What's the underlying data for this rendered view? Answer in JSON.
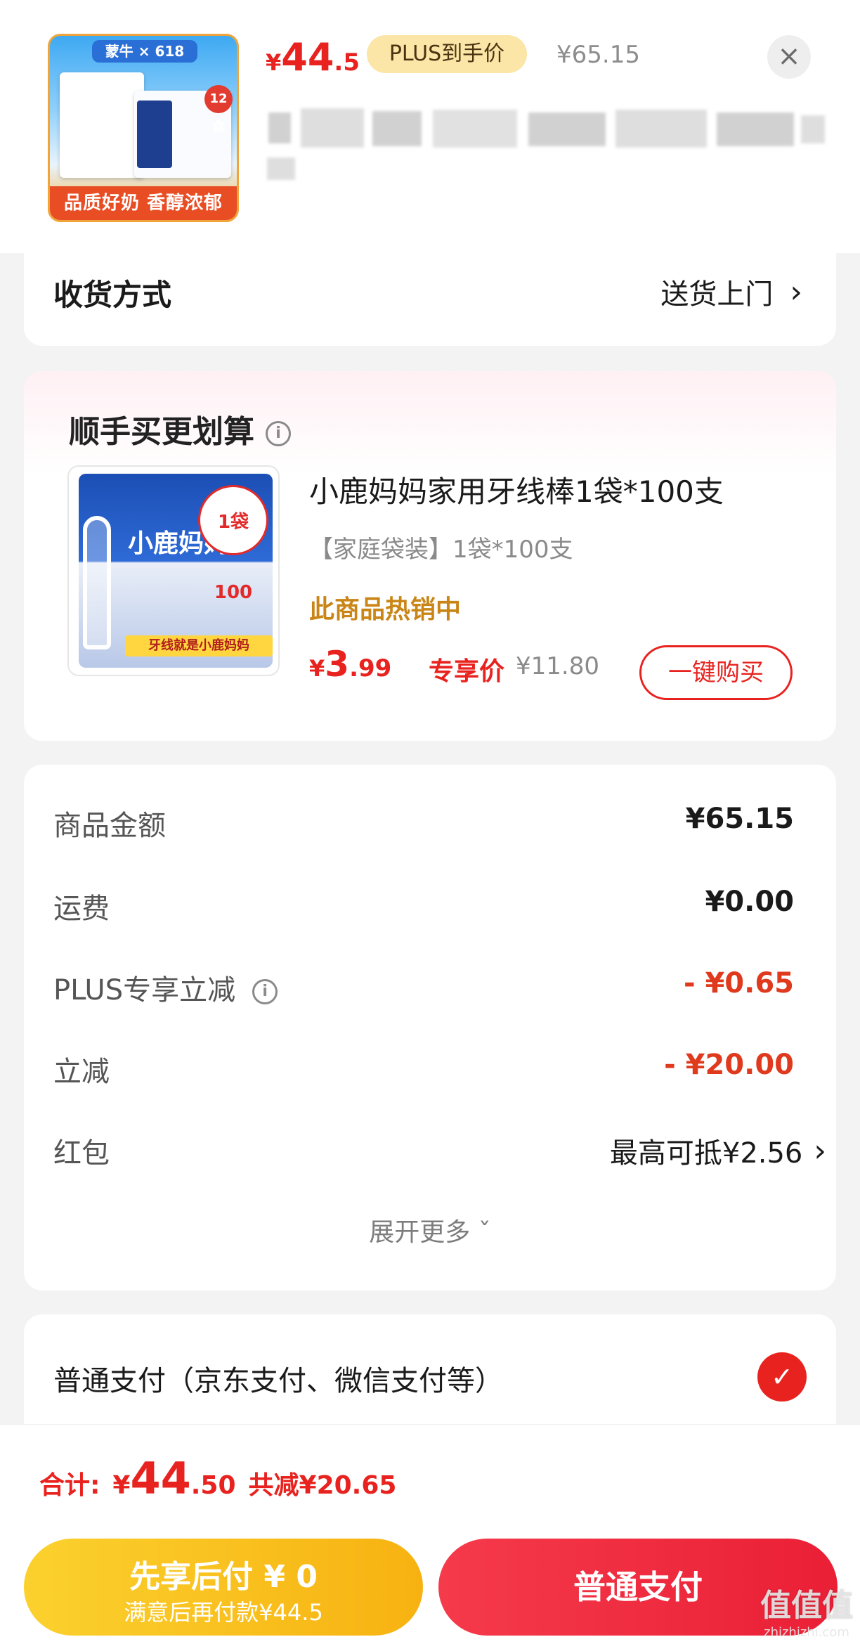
{
  "header": {
    "thumb_brand": "蒙牛 × 618",
    "thumb_count": "12盒",
    "thumb_slogan": "品质好奶 香醇浓郁",
    "price_yen": "¥",
    "price_int": "44",
    "price_dec": ".5",
    "plus_label": "PLUS到手价",
    "original_price": "¥65.15",
    "close_glyph": "×"
  },
  "delivery": {
    "label": "收货方式",
    "value": "送货上门"
  },
  "bundle": {
    "title": "顺手买更划算",
    "product": {
      "image_brand": "小鹿妈妈",
      "image_badge": "1袋100",
      "image_strip": "牙线就是小鹿妈妈",
      "name": "小鹿妈妈家用牙线棒1袋*100支",
      "spec": "【家庭袋装】1袋*100支",
      "hot": "此商品热销中",
      "price_yen": "¥",
      "price_int": "3",
      "price_dec": ".99",
      "exclusive_label": "专享价",
      "original_price": "¥11.80",
      "buy_label": "一键购买"
    }
  },
  "summary": {
    "rows": [
      {
        "label": "商品金额",
        "value": "¥65.15"
      },
      {
        "label": "运费",
        "value": "¥0.00"
      },
      {
        "label": "PLUS专享立减",
        "value": "- ¥0.65"
      },
      {
        "label": "立减",
        "value": "- ¥20.00"
      },
      {
        "label": "红包",
        "value": "最高可抵¥2.56"
      }
    ],
    "expand_label": "展开更多 ˇ"
  },
  "payment": {
    "option_label": "普通支付（京东支付、微信支付等）",
    "check_glyph": "✓"
  },
  "footer": {
    "total_label": "合计:",
    "total_yen": "¥",
    "total_int": "44",
    "total_dec": ".50",
    "total_saved": "共减¥20.65",
    "bnpl_main": "先享后付 ¥ 0",
    "bnpl_sub": "满意后再付款¥44.5",
    "pay_label": "普通支付"
  },
  "watermark": {
    "main": "值值值",
    "sub": "zhizhizhi.com"
  },
  "colors": {
    "accent_red": "#e8231f",
    "gold": "#f7b211",
    "hot_text": "#c98617"
  },
  "icons": {
    "info": "info-icon",
    "chevron": "chevron-right-icon",
    "check": "check-circle-icon",
    "close": "close-icon"
  },
  "chevron_glyph": "›",
  "info_glyph": "i"
}
